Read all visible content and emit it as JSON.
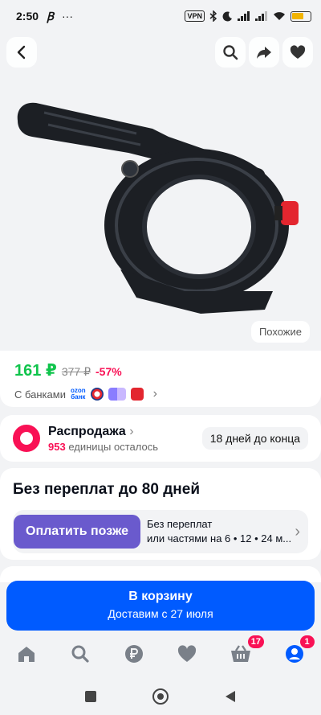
{
  "status_bar": {
    "time": "2:50",
    "vpn": "VPN",
    "battery_percent": 62
  },
  "product": {
    "similar_label": "Похожие"
  },
  "price": {
    "current": "161 ₽",
    "old": "377 ₽",
    "discount": "-57%",
    "banks_label": "С банками",
    "ozon_bank_line1": "ozon",
    "ozon_bank_line2": "банк"
  },
  "sale": {
    "title": "Распродажа",
    "chevron": "›",
    "count": "953",
    "count_suffix": "единицы осталось",
    "deadline": "18 дней до конца"
  },
  "bnpl": {
    "title": "Без переплат до 80 дней",
    "button_label": "Оплатить позже",
    "info_line1": "Без переплат",
    "info_line2": "или частями на 6 • 12 • 24 м..."
  },
  "cart": {
    "title": "В корзину",
    "delivery": "Доставим с 27 июля"
  },
  "tabbar": {
    "cart_badge": "17",
    "profile_badge": "1"
  },
  "colors": {
    "accent_blue": "#005bff",
    "price_green": "#10c44c",
    "discount_pink": "#f91155",
    "bnpl_purple": "#6a5acd"
  },
  "icons": [
    "back-icon",
    "search-icon",
    "share-icon",
    "heart-icon",
    "home-icon",
    "catalog-search-icon",
    "ruble-icon",
    "favorites-icon",
    "cart-icon",
    "profile-icon"
  ]
}
